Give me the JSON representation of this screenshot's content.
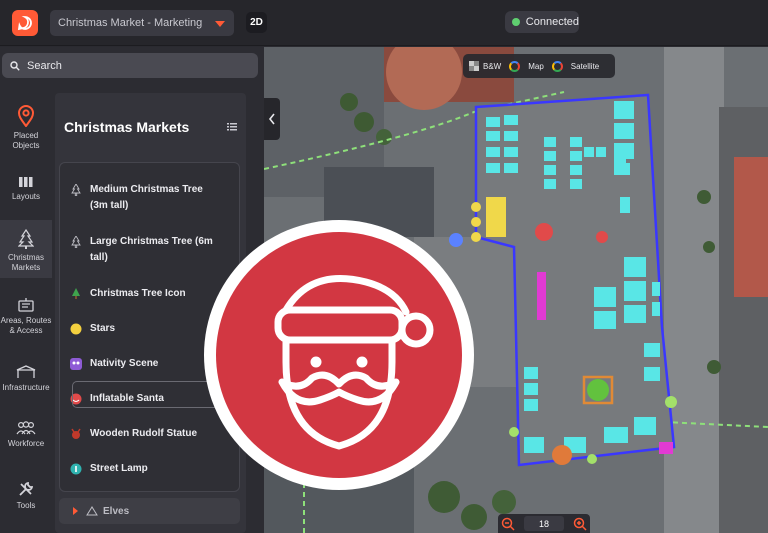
{
  "topbar": {
    "project_name": "Christmas Market - Marketing",
    "view_mode": "2D",
    "connection_status": "Connected",
    "connection_color": "#5fcf70",
    "accent_color": "#ff5a36"
  },
  "search": {
    "placeholder": "Search"
  },
  "rail": [
    {
      "label": "Placed Objects",
      "icon": "pin-icon"
    },
    {
      "label": "Layouts",
      "icon": "columns-icon"
    },
    {
      "label": "Christmas Markets",
      "icon": "tree-icon"
    },
    {
      "label": "Areas, Routes & Access",
      "icon": "routes-icon"
    },
    {
      "label": "Infrastructure",
      "icon": "tent-icon"
    },
    {
      "label": "Workforce",
      "icon": "people-icon"
    },
    {
      "label": "Tools",
      "icon": "wrench-icon"
    }
  ],
  "category": {
    "title": "Christmas Markets",
    "items": [
      {
        "label": "Medium Christmas Tree (3m tall)",
        "icon": "tree-outline-icon"
      },
      {
        "label": "Large Christmas Tree (6m tall)",
        "icon": "tree-outline-icon"
      },
      {
        "label": "Christmas Tree Icon",
        "icon": "green-tree-icon"
      },
      {
        "label": "Stars",
        "icon": "star-dot-icon"
      },
      {
        "label": "Nativity Scene",
        "icon": "nativity-icon"
      },
      {
        "label": "Inflatable Santa",
        "icon": "santa-dot-icon"
      },
      {
        "label": "Wooden Rudolf Statue",
        "icon": "rudolf-icon"
      },
      {
        "label": "Street Lamp",
        "icon": "lamp-icon"
      }
    ],
    "selected_index": 5,
    "collapsed_group": "Elves"
  },
  "map": {
    "layers": [
      "B&W",
      "Map",
      "Satellite"
    ],
    "zoom": "18"
  }
}
